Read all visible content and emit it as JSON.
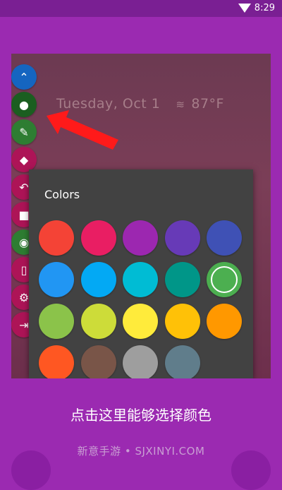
{
  "status_bar": {
    "time": "8:29"
  },
  "preview": {
    "date": "Tuesday, Oct 1",
    "temperature": "87°F"
  },
  "tools": [
    {
      "name": "collapse",
      "icon": "chevron-up-icon",
      "glyph": "⌃",
      "color": "#1565c0"
    },
    {
      "name": "colors",
      "icon": "palette-icon",
      "glyph": "●",
      "color": "#1b5e20"
    },
    {
      "name": "brush",
      "icon": "brush-icon",
      "glyph": "✎",
      "color": "#2e7d32"
    },
    {
      "name": "eraser",
      "icon": "eraser-icon",
      "glyph": "◆",
      "color": "#ad1457"
    },
    {
      "name": "undo",
      "icon": "undo-icon",
      "glyph": "↶",
      "color": "#ad1457"
    },
    {
      "name": "delete",
      "icon": "trash-icon",
      "glyph": "■",
      "color": "#ad1457"
    },
    {
      "name": "visibility",
      "icon": "eye-off-icon",
      "glyph": "◉",
      "color": "#2e7d32"
    },
    {
      "name": "vibrate",
      "icon": "vibrate-icon",
      "glyph": "▯",
      "color": "#ad1457"
    },
    {
      "name": "settings",
      "icon": "gear-icon",
      "glyph": "⚙",
      "color": "#ad1457"
    },
    {
      "name": "exit",
      "icon": "exit-icon",
      "glyph": "⇥",
      "color": "#ad1457"
    }
  ],
  "colors_panel": {
    "title": "Colors",
    "selected": "#4caf50",
    "swatches": [
      "#f44336",
      "#e91e63",
      "#9c27b0",
      "#673ab7",
      "#3f51b5",
      "#2196f3",
      "#03a9f4",
      "#00bcd4",
      "#009688",
      "#4caf50",
      "#8bc34a",
      "#cddc39",
      "#ffeb3b",
      "#ffc107",
      "#ff9800",
      "#ff5722",
      "#795548",
      "#9e9e9e",
      "#607d8b"
    ]
  },
  "caption": "点击这里能够选择颜色",
  "watermark": "新意手游 • SJXINYI.COM"
}
